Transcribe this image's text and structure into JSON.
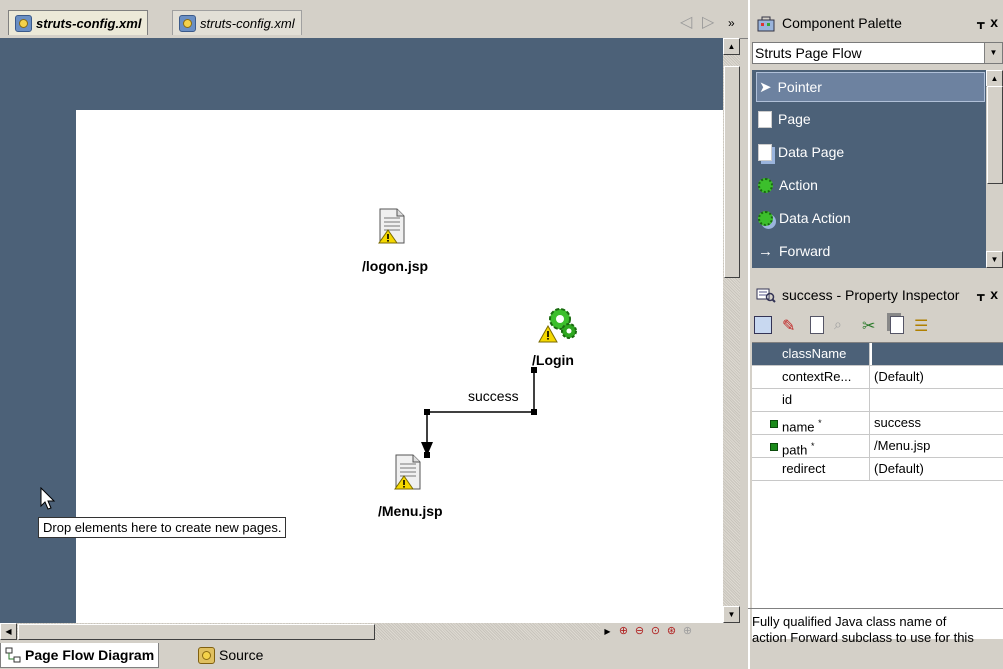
{
  "editor": {
    "tabs": [
      {
        "label": "struts-config.xml",
        "active": true
      },
      {
        "label": "struts-config.xml",
        "active": false
      }
    ],
    "bottom_tabs": [
      {
        "label": "Page Flow Diagram",
        "active": true
      },
      {
        "label": "Source",
        "active": false
      }
    ]
  },
  "diagram": {
    "nodes": [
      {
        "label": "/logon.jsp",
        "type": "page",
        "warning": true
      },
      {
        "label": "/Login",
        "type": "action",
        "warning": true
      },
      {
        "label": "/Menu.jsp",
        "type": "page",
        "warning": true
      }
    ],
    "forward_label": "success",
    "tooltip": "Drop elements here to create new pages."
  },
  "palette": {
    "title": "Component Palette",
    "selected_page": "Struts Page Flow",
    "items": [
      {
        "label": "Pointer",
        "icon": "pointer-icon",
        "selected": true
      },
      {
        "label": "Page",
        "icon": "page-icon",
        "selected": false
      },
      {
        "label": "Data Page",
        "icon": "data-page-icon",
        "selected": false
      },
      {
        "label": "Action",
        "icon": "action-icon",
        "selected": false
      },
      {
        "label": "Data Action",
        "icon": "data-action-icon",
        "selected": false
      },
      {
        "label": "Forward",
        "icon": "forward-arrow-icon",
        "selected": false
      }
    ]
  },
  "inspector": {
    "title": "success - Property Inspector",
    "properties": [
      {
        "name": "className",
        "value": "",
        "required": false,
        "selected": true
      },
      {
        "name": "contextRe...",
        "value": "(Default)",
        "required": false,
        "selected": false
      },
      {
        "name": "id",
        "value": "",
        "required": false,
        "selected": false
      },
      {
        "name": "name",
        "value": "success",
        "required": true,
        "selected": false
      },
      {
        "name": "path",
        "value": "/Menu.jsp",
        "required": true,
        "selected": false
      },
      {
        "name": "redirect",
        "value": "(Default)",
        "required": false,
        "selected": false
      }
    ],
    "description": "Fully qualified Java class name of",
    "description_cont": "action Forward subclass to use for this"
  },
  "colors": {
    "canvas_background": "#4c6178",
    "page_background": "#ffffff",
    "selection": "#4c6178",
    "required_marker": "#1a8a1a"
  }
}
